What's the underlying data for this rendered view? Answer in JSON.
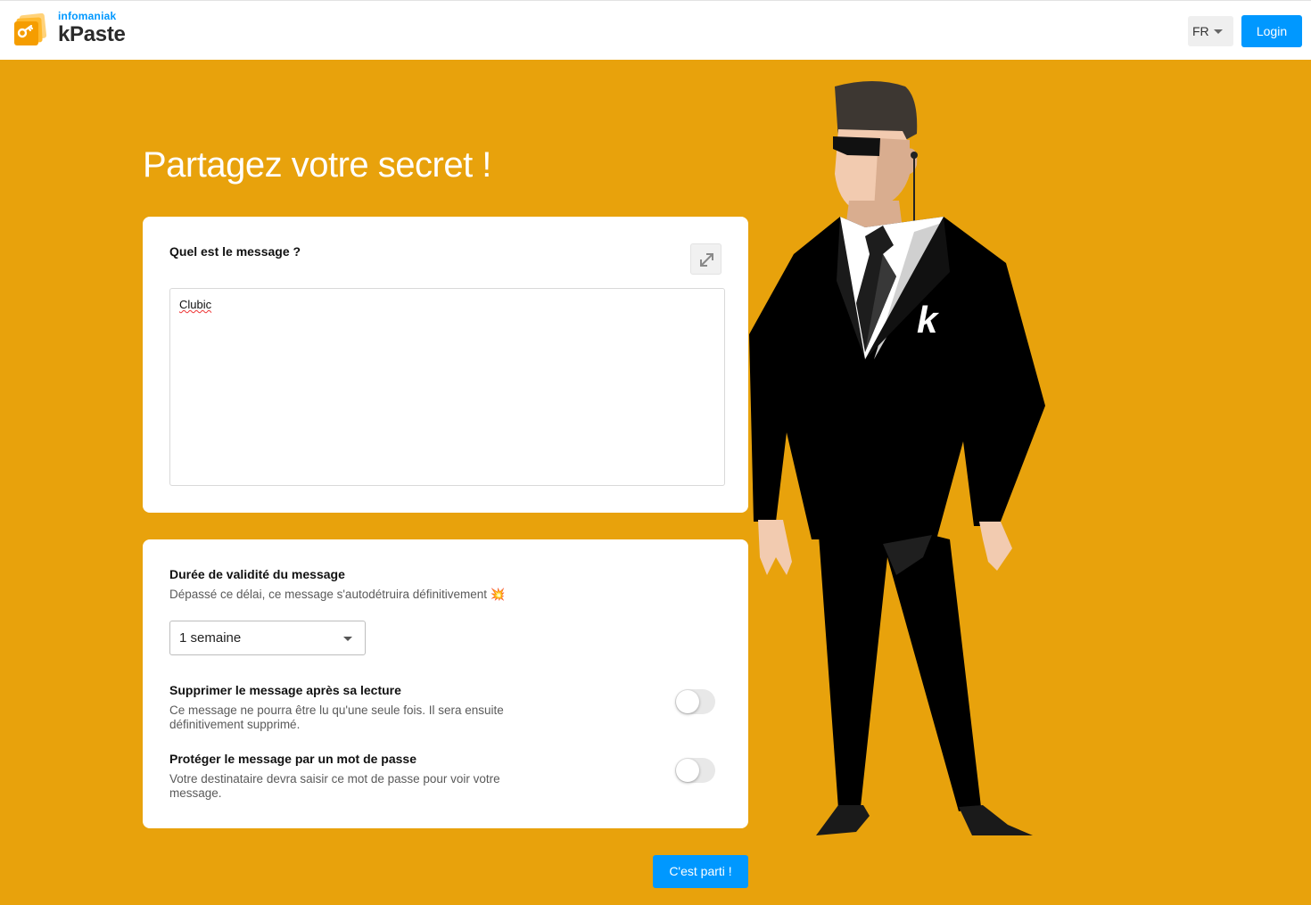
{
  "header": {
    "brand_company": "infomaniak",
    "brand_product": "kPaste",
    "language": "FR",
    "login_label": "Login"
  },
  "page": {
    "title": "Partagez votre secret !"
  },
  "message_card": {
    "label": "Quel est le message ?",
    "content": "Clubic"
  },
  "options_card": {
    "validity_title": "Durée de validité du message",
    "validity_desc": "Dépassé ce délai, ce message s'autodétruira définitivement 💥",
    "validity_value": "1 semaine",
    "burn_title": "Supprimer le message après sa lecture",
    "burn_desc": "Ce message ne pourra être lu qu'une seule fois. Il sera ensuite définitivement supprimé.",
    "burn_enabled": false,
    "password_title": "Protéger le message par un mot de passe",
    "password_desc": "Votre destinataire devra saisir ce mot de passe pour voir votre message.",
    "password_enabled": false
  },
  "submit_label": "C'est parti !",
  "colors": {
    "background": "#e8a20c",
    "accent": "#0098ff"
  }
}
